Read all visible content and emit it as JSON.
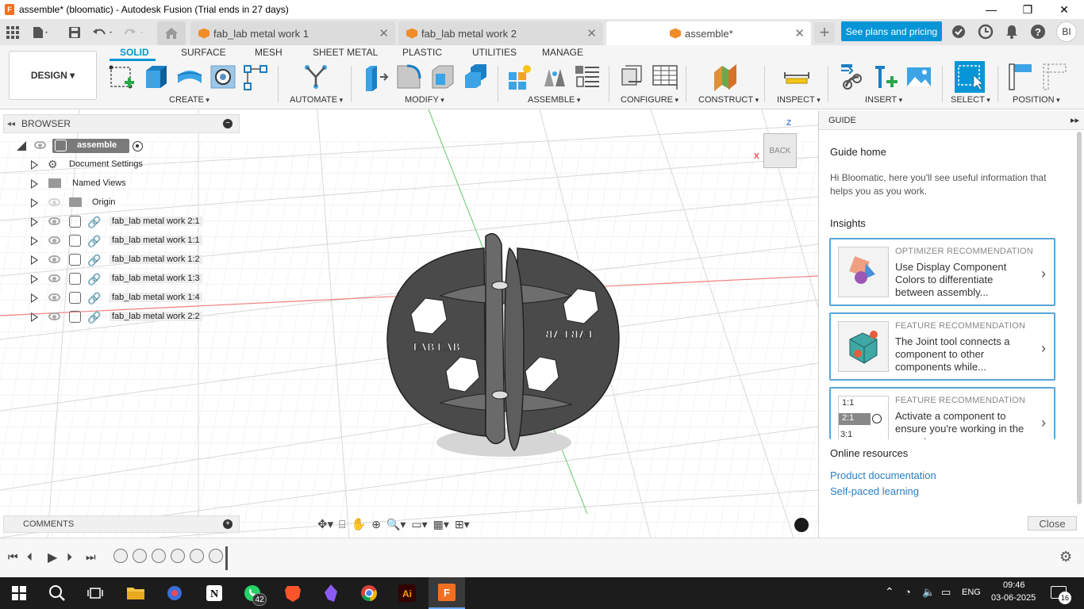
{
  "window": {
    "title": "assemble* (bloomatic) - Autodesk Fusion (Trial ends in 27 days)",
    "minimize": "—",
    "maximize": "❐",
    "close": "✕"
  },
  "tabs": [
    {
      "label": "fab_lab metal work 1",
      "active": false
    },
    {
      "label": "fab_lab metal work 2",
      "active": false
    },
    {
      "label": "assemble*",
      "active": true
    }
  ],
  "plans_button": "See plans and pricing",
  "user_initials": "BI",
  "workspace": "DESIGN",
  "ribbon_tabs": [
    "SOLID",
    "SURFACE",
    "MESH",
    "SHEET METAL",
    "PLASTIC",
    "UTILITIES",
    "MANAGE"
  ],
  "ribbon_groups": [
    "CREATE",
    "AUTOMATE",
    "MODIFY",
    "ASSEMBLE",
    "CONFIGURE",
    "CONSTRUCT",
    "INSPECT",
    "INSERT",
    "SELECT",
    "POSITION"
  ],
  "browser": {
    "title": "BROWSER",
    "root": "assemble",
    "items": [
      {
        "label": "Document Settings",
        "icon": "gear-icon"
      },
      {
        "label": "Named Views",
        "icon": "folder-icon"
      },
      {
        "label": "Origin",
        "icon": "folder-icon"
      },
      {
        "label": "fab_lab metal work 2:1",
        "icon": "component-icon"
      },
      {
        "label": "fab_lab metal work 1:1",
        "icon": "component-icon"
      },
      {
        "label": "fab_lab metal work 1:2",
        "icon": "component-icon"
      },
      {
        "label": "fab_lab metal work 1:3",
        "icon": "component-icon"
      },
      {
        "label": "fab_lab metal work 1:4",
        "icon": "component-icon"
      },
      {
        "label": "fab_lab metal work 2:2",
        "icon": "component-icon"
      }
    ]
  },
  "viewcube": {
    "face": "BACK",
    "axis_z": "Z",
    "axis_x": "X"
  },
  "model": {
    "text_left": "FAB LAB",
    "text_right": "FAB LAB"
  },
  "comments": "COMMENTS",
  "guide": {
    "title": "GUIDE",
    "home": "Guide home",
    "intro": "Hi Bloomatic, here you'll see useful information that helps you as you work.",
    "insights": "Insights",
    "cards": [
      {
        "kind": "OPTIMIZER RECOMMENDATION",
        "desc": "Use Display Component Colors to differentiate between assembly..."
      },
      {
        "kind": "FEATURE RECOMMENDATION",
        "desc": "The Joint tool connects a component to other components while..."
      },
      {
        "kind": "FEATURE RECOMMENDATION",
        "desc": "Activate a component to ensure you're working in the correct c..."
      }
    ],
    "scale_labels": [
      "1:1",
      "2:1",
      "3:1"
    ],
    "online": "Online resources",
    "links": [
      "Product documentation",
      "Self-paced learning"
    ],
    "close": "Close"
  },
  "taskbar": {
    "whatsapp_badge": "42",
    "lang": "ENG",
    "time": "09:46",
    "date": "03-06-2025",
    "notif": "16"
  },
  "colors": {
    "accent": "#0696d7",
    "model": "#4a4a4a"
  }
}
